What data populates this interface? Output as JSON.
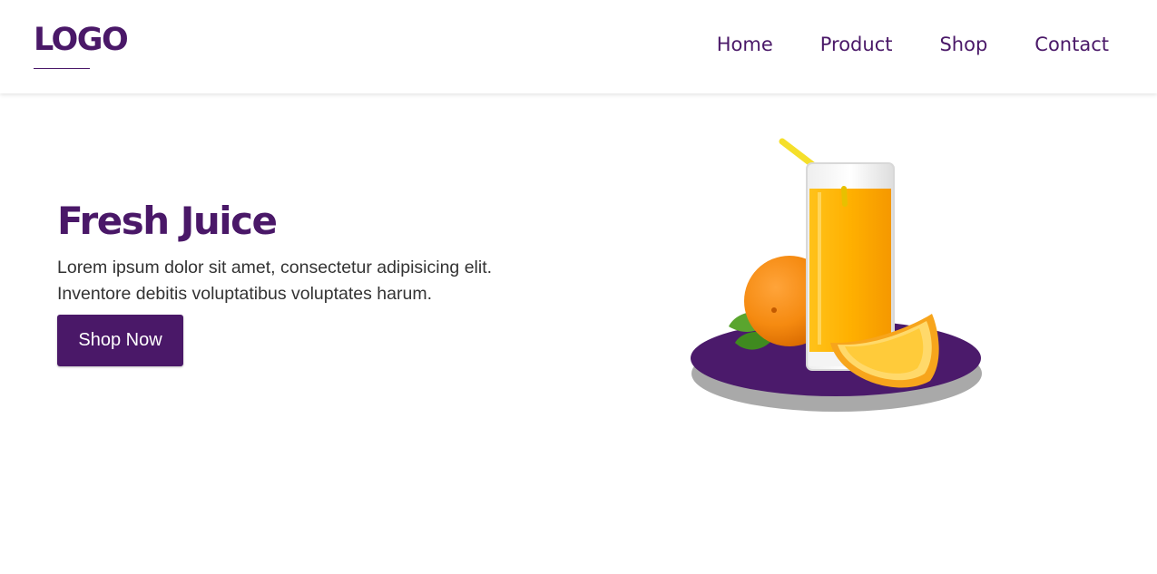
{
  "header": {
    "logo": "LOGO",
    "nav": [
      {
        "label": "Home"
      },
      {
        "label": "Product"
      },
      {
        "label": "Shop"
      },
      {
        "label": "Contact"
      }
    ]
  },
  "hero": {
    "title": "Fresh Juice",
    "text": "Lorem ipsum dolor sit amet, consectetur adipisicing elit. Inventore debitis voluptatibus voluptates harum.",
    "button_label": "Shop Now"
  },
  "colors": {
    "brand": "#4a1868",
    "plate": "#4b1a6b",
    "juice": "#ffb300",
    "orange": "#f59a1b"
  }
}
